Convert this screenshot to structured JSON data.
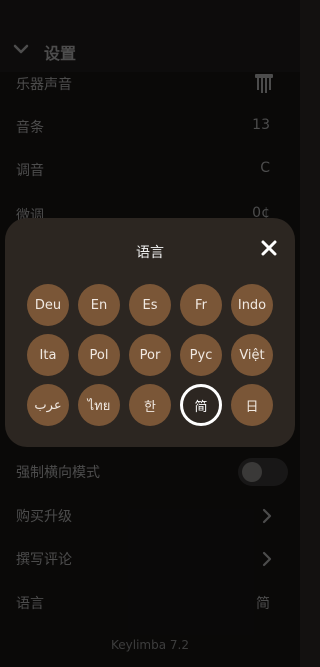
{
  "header": {
    "title": "设置"
  },
  "settings": [
    {
      "label": "乐器声音",
      "value": "",
      "icon": "kalimba-icon"
    },
    {
      "label": "音条",
      "value": "13"
    },
    {
      "label": "调音",
      "value": "C"
    },
    {
      "label": "微调",
      "value": "0¢"
    }
  ],
  "lower_settings": [
    {
      "label": "强制横向模式",
      "value": ""
    },
    {
      "label": "购买升级",
      "value": ""
    },
    {
      "label": "撰写评论",
      "value": ""
    },
    {
      "label": "语言",
      "value": "简"
    }
  ],
  "modal": {
    "title": "语言",
    "close_icon": "close-icon",
    "languages": [
      "Deu",
      "En",
      "Es",
      "Fr",
      "Indo",
      "Ita",
      "Pol",
      "Por",
      "Рус",
      "Việt",
      "عرب",
      "ไทย",
      "한",
      "简",
      "日"
    ],
    "selected": "简"
  },
  "toggle": {
    "state": "off"
  },
  "footer": {
    "version": "Keylimba 7.2"
  },
  "colors": {
    "background": "#131110",
    "modal": "#2c2621",
    "chip": "#7a5637",
    "selected_ring": "#ffffff"
  }
}
